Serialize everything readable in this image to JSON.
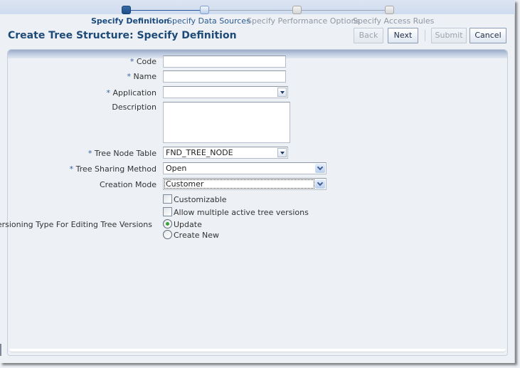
{
  "train": {
    "stops": [
      {
        "label": "Specify Definition",
        "state": "current"
      },
      {
        "label": "Specify Data Sources",
        "state": "next"
      },
      {
        "label": "Specify Performance Options",
        "state": "future"
      },
      {
        "label": "Specify Access Rules",
        "state": "future"
      }
    ]
  },
  "header": {
    "title": "Create Tree Structure: Specify Definition"
  },
  "buttons": {
    "back": {
      "label": "Back",
      "enabled": false
    },
    "next": {
      "label": "Next",
      "enabled": true
    },
    "submit": {
      "label": "Submit",
      "enabled": false
    },
    "cancel": {
      "label": "Cancel",
      "enabled": true
    }
  },
  "form": {
    "required_marker": "*",
    "code": {
      "label": "Code",
      "value": "",
      "required": true
    },
    "name": {
      "label": "Name",
      "value": "",
      "required": true
    },
    "application": {
      "label": "Application",
      "value": "",
      "required": true
    },
    "description": {
      "label": "Description",
      "value": "",
      "required": false
    },
    "tree_node_table": {
      "label": "Tree Node Table",
      "value": "FND_TREE_NODE",
      "required": true
    },
    "tree_sharing_method": {
      "label": "Tree Sharing Method",
      "value": "Open",
      "required": true
    },
    "creation_mode": {
      "label": "Creation Mode",
      "value": "Customer",
      "required": false
    },
    "customizable": {
      "label": "Customizable",
      "checked": false
    },
    "allow_multiple": {
      "label": "Allow multiple active tree versions",
      "checked": false
    },
    "versioning_type": {
      "label": "Versioning Type For Editing Tree Versions",
      "options": [
        {
          "label": "Update",
          "selected": true
        },
        {
          "label": "Create New",
          "selected": false
        }
      ]
    }
  }
}
